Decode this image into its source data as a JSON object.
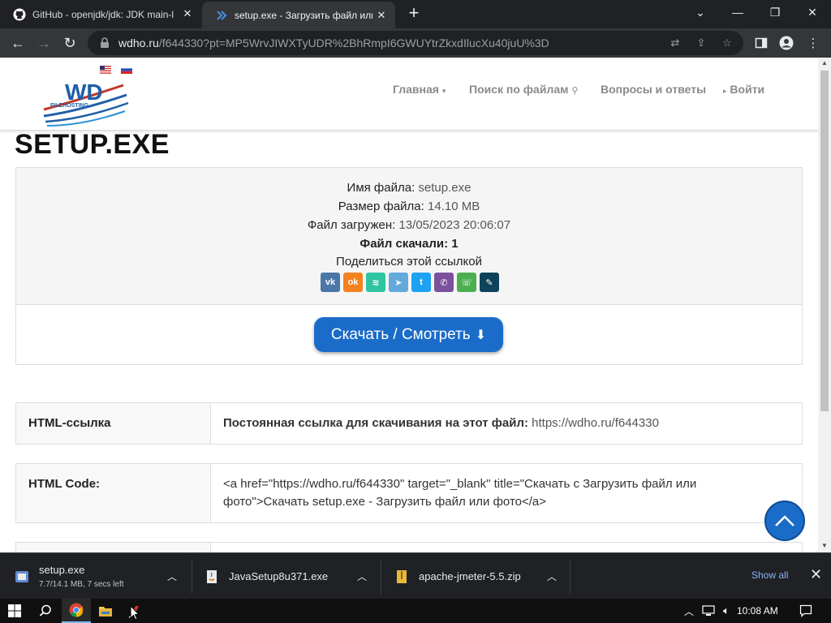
{
  "browser": {
    "tabs": [
      {
        "title": "GitHub - openjdk/jdk: JDK main-l",
        "active": false,
        "icon": "github-icon"
      },
      {
        "title": "setup.exe - Загрузить файл или",
        "active": true,
        "icon": "wdho-favicon-icon"
      }
    ],
    "url_host": "wdho.ru",
    "url_path": "/f644330?pt=MP5WrvJIWXTyUDR%2BhRmpI6GWUYtrZkxdIlucXu40juU%3D"
  },
  "site": {
    "lang_flags": [
      "us-flag-icon",
      "ru-flag-icon"
    ],
    "logo_text": "WD",
    "logo_sub": "FILEHOSTING",
    "nav": {
      "home": "Главная",
      "search": "Поиск по файлам",
      "faq": "Вопросы и ответы",
      "login": "Войти"
    }
  },
  "file": {
    "heading": "SETUP.EXE",
    "name_label": "Имя файла:",
    "name_value": "setup.exe",
    "size_label": "Размер файла:",
    "size_value": "14.10 MB",
    "uploaded_label": "Файл загружен:",
    "uploaded_value": "13/05/2023 20:06:07",
    "downloads_text": "Файл скачали: 1",
    "share_label": "Поделиться этой ссылкой",
    "share_buttons": [
      "vk-icon",
      "odnoklassniki-icon",
      "yandex-messenger-icon",
      "telegram-icon",
      "twitter-icon",
      "viber-icon",
      "whatsapp-icon",
      "livejournal-icon"
    ],
    "download_button": "Скачать / Смотреть"
  },
  "links": [
    {
      "label": "HTML-ссылка",
      "value_bold": "Постоянная ссылка для скачивания на этот файл:",
      "value": "https://wdho.ru/f644330"
    },
    {
      "label": "HTML Code:",
      "value_line1": "<a href=\"https://wdho.ru/f644330\" target=\"_blank\" title=\"Скачать с Загрузить файл или",
      "value_line2": "фото\">Скачать setup.exe - Загрузить файл или фото</a>"
    }
  ],
  "downloads_bar": {
    "items": [
      {
        "name": "setup.exe",
        "status": "7.7/14.1 MB, 7 secs left"
      },
      {
        "name": "JavaSetup8u371.exe",
        "status": ""
      },
      {
        "name": "apache-jmeter-5.5.zip",
        "status": ""
      }
    ],
    "show_all": "Show all"
  },
  "taskbar": {
    "time": "10:08 AM"
  },
  "colors": {
    "accent_blue": "#1a6cc8",
    "chrome_dark": "#202124",
    "chrome_toolbar": "#35363a"
  }
}
